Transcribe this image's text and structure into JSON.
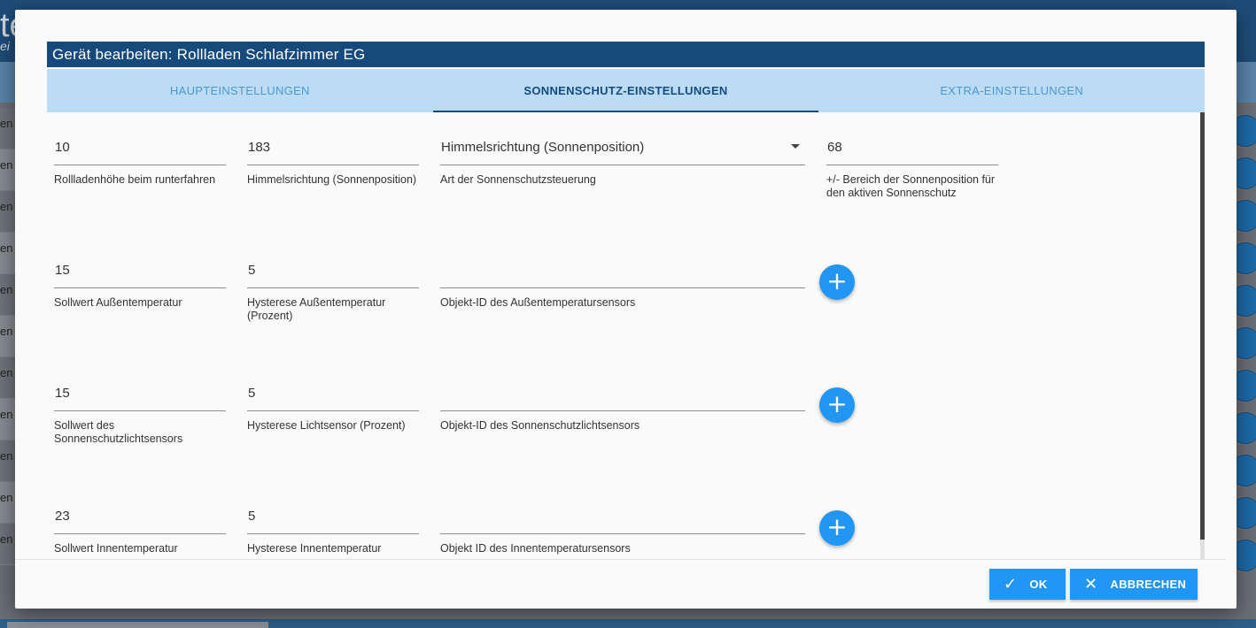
{
  "background": {
    "title_fragment": "te",
    "subtitle_fragment": "ei",
    "row_labels": [
      "en",
      "en",
      "en",
      "en",
      "en",
      "en",
      "en",
      "en",
      "en",
      "en",
      "en"
    ]
  },
  "dialog": {
    "title": "Gerät bearbeiten: Rollladen Schlafzimmer EG",
    "tabs": [
      {
        "label": "HAUPTEINSTELLUNGEN",
        "active": false
      },
      {
        "label": "SONNENSCHUTZ-EINSTELLUNGEN",
        "active": true
      },
      {
        "label": "EXTRA-EINSTELLUNGEN",
        "active": false
      }
    ],
    "row1": {
      "height": {
        "value": "10",
        "label": "Rollladenhöhe beim runterfahren"
      },
      "direction": {
        "value": "183",
        "label": "Himmelsrichtung (Sonnenposition)"
      },
      "mode": {
        "value": "Himmelsrichtung (Sonnenposition)",
        "label": "Art der Sonnenschutzsteuerung"
      },
      "range": {
        "value": "68",
        "label": "+/- Bereich der Sonnenposition für den aktiven Sonnenschutz"
      }
    },
    "row2": {
      "setpoint": {
        "value": "15",
        "label": "Sollwert Außentemperatur"
      },
      "hysteresis": {
        "value": "5",
        "label": "Hysterese Außentemperatur (Prozent)"
      },
      "object": {
        "value": "",
        "label": "Objekt-ID des Außentemperatursensors"
      }
    },
    "row3": {
      "setpoint": {
        "value": "15",
        "label": "Sollwert des Sonnenschutzlichtsensors"
      },
      "hysteresis": {
        "value": "5",
        "label": "Hysterese Lichtsensor (Prozent)"
      },
      "object": {
        "value": "",
        "label": "Objekt-ID des Sonnenschutzlichtsensors"
      }
    },
    "row4": {
      "setpoint": {
        "value": "23",
        "label": "Sollwert Innentemperatur"
      },
      "hysteresis": {
        "value": "5",
        "label": "Hysterese Innentemperatur"
      },
      "object": {
        "value": "",
        "label": "Objekt ID des Innentemperatursensors"
      }
    },
    "buttons": {
      "ok": "OK",
      "cancel": "ABBRECHEN"
    },
    "colors": {
      "title_bar": "#174a7c",
      "tab_bar": "#bcdcf6",
      "accent": "#2196f3"
    }
  }
}
